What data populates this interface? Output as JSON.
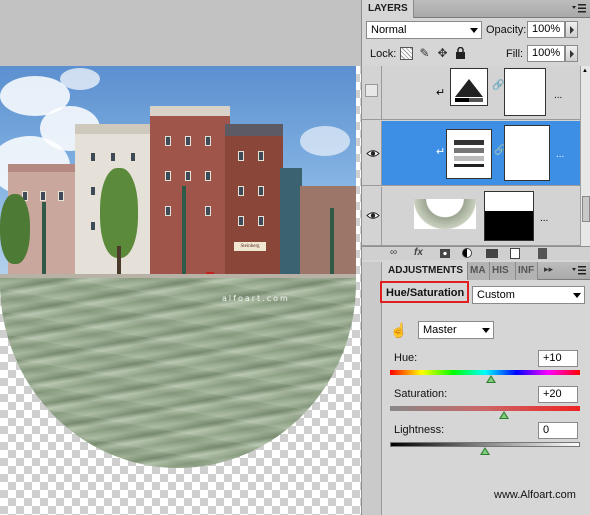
{
  "layers_panel": {
    "tab_label": "LAYERS",
    "blend_mode": "Normal",
    "opacity_label": "Opacity:",
    "opacity_value": "100%",
    "lock_label": "Lock:",
    "fill_label": "Fill:",
    "fill_value": "100%",
    "layers": [
      {
        "kind": "adjustment-levels",
        "visible": false,
        "clipped": true
      },
      {
        "kind": "adjustment-hue-saturation",
        "visible": true,
        "clipped": true,
        "selected": true
      },
      {
        "kind": "image-water",
        "visible": true,
        "clipped": false
      }
    ],
    "footer_icons": [
      "link-icon",
      "fx-icon",
      "mask-icon",
      "adjustment-icon",
      "folder-icon",
      "new-layer-icon",
      "trash-icon"
    ],
    "footer_fx_text": "fx"
  },
  "adjustments_panel": {
    "tabs": [
      {
        "label": "ADJUSTMENTS",
        "active": true
      },
      {
        "label": "MA",
        "active": false
      },
      {
        "label": "HIS",
        "active": false
      },
      {
        "label": "INF",
        "active": false
      }
    ],
    "title": "Hue/Saturation",
    "preset": "Custom",
    "channel": "Master",
    "hue": {
      "label": "Hue:",
      "value": "+10",
      "fraction": 0.53
    },
    "saturation": {
      "label": "Saturation:",
      "value": "+20",
      "fraction": 0.6
    },
    "lightness": {
      "label": "Lightness:",
      "value": "0",
      "fraction": 0.5
    }
  },
  "canvas": {
    "watermark": "alfoart.com",
    "sign": "Steinberg"
  },
  "credit": "www.Alfoart.com",
  "colors": {
    "selected_layer": "#3d8fe6",
    "highlight_box": "#e02020"
  }
}
